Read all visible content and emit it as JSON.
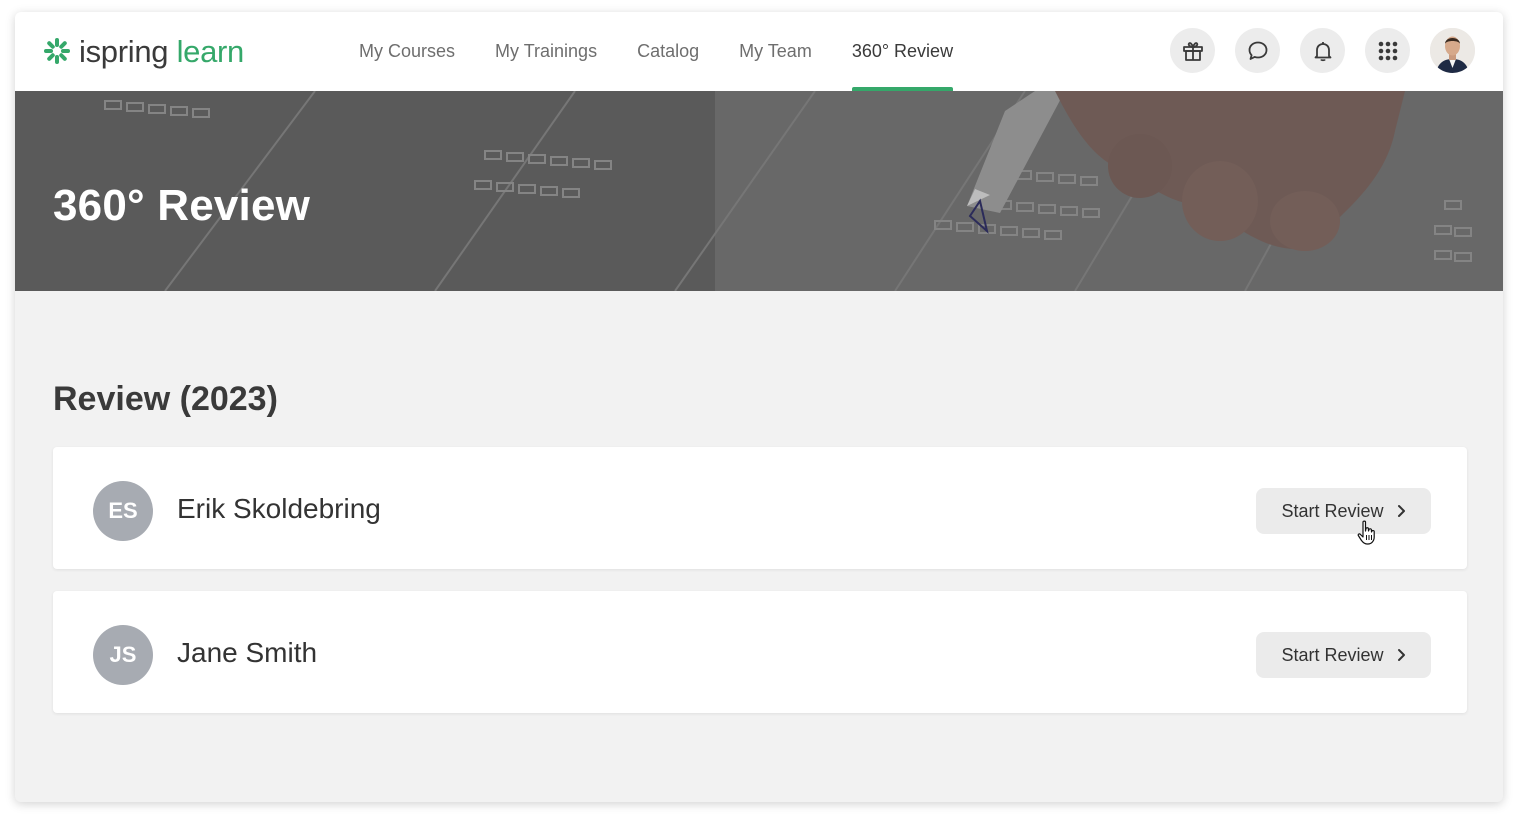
{
  "brand": {
    "logo_word1": "ispring",
    "logo_word2": "learn",
    "accent_color": "#35a86a"
  },
  "nav": {
    "items": [
      {
        "label": "My Courses"
      },
      {
        "label": "My Trainings"
      },
      {
        "label": "Catalog"
      },
      {
        "label": "My Team"
      },
      {
        "label": "360° Review",
        "active": true
      }
    ]
  },
  "toolbar": {
    "icons": [
      "gift-icon",
      "chat-icon",
      "bell-icon",
      "apps-grid-icon",
      "user-avatar"
    ]
  },
  "banner": {
    "title": "360° Review"
  },
  "section": {
    "title": "Review (2023)"
  },
  "reviews": [
    {
      "initials": "ES",
      "name": "Erik Skoldebring",
      "button_label": "Start Review"
    },
    {
      "initials": "JS",
      "name": "Jane Smith",
      "button_label": "Start Review"
    }
  ]
}
